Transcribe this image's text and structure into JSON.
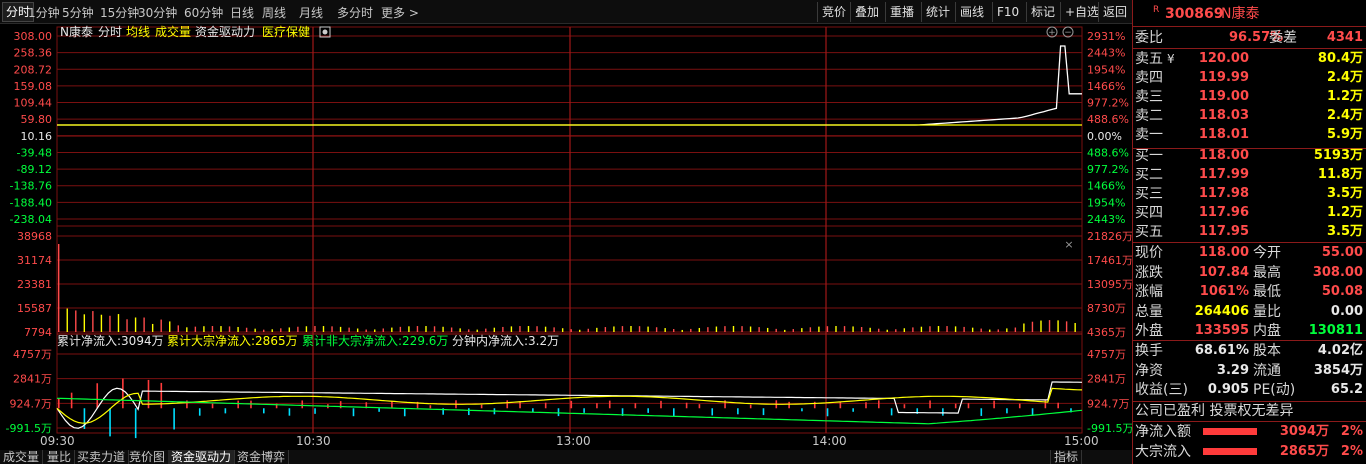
{
  "toolbar": {
    "periods": [
      "分时",
      "1分钟",
      "5分钟",
      "15分钟",
      "30分钟",
      "60分钟",
      "日线",
      "周线",
      "月线",
      "多分时",
      "更多 >"
    ],
    "active_index": 0,
    "right_buttons": [
      "竞价",
      "叠加",
      "重播",
      "统计",
      "画线",
      "F10",
      "标记",
      "+自选",
      "返回"
    ]
  },
  "chart_header": {
    "name": "N康泰",
    "mode": "分时",
    "avg": "均线",
    "volume": "成交量",
    "fund": "资金驱动力",
    "sector": "医疗保健"
  },
  "price_panel": {
    "left_ticks": [
      "308.00",
      "258.36",
      "208.72",
      "159.08",
      "109.44",
      "59.80",
      "10.16",
      "-39.48",
      "-89.12",
      "-138.76",
      "-188.40",
      "-238.04"
    ],
    "right_ticks": [
      "2931%",
      "2443%",
      "1954%",
      "1466%",
      "977.2%",
      "488.6%",
      "0.00%",
      "488.6%",
      "977.2%",
      "1466%",
      "1954%",
      "2443%"
    ]
  },
  "volume_panel": {
    "left_ticks": [
      "38968",
      "31174",
      "23381",
      "15587",
      "7794"
    ],
    "right_ticks": [
      "21826万",
      "17461万",
      "13095万",
      "8730万",
      "4365万"
    ]
  },
  "flow_panel": {
    "legend": [
      {
        "text": "累计净流入:3094万",
        "color": "#e8e8e8"
      },
      {
        "text": "累计大宗净流入:2865万",
        "color": "#ffff00"
      },
      {
        "text": "累计非大宗净流入:229.6万",
        "color": "#00ff3c"
      },
      {
        "text": "分钟内净流入:3.2万",
        "color": "#e8e8e8"
      }
    ],
    "left_ticks": [
      "4757万",
      "2841万",
      "924.7万",
      "-991.5万"
    ],
    "right_ticks": [
      "4757万",
      "2841万",
      "924.7万",
      "-991.5万"
    ]
  },
  "time_axis": [
    "09:30",
    "10:30",
    "13:00",
    "14:00",
    "15:00"
  ],
  "bottom_tabs": [
    "成交量",
    "量比",
    "买卖力道",
    "竞价图",
    "资金驱动力",
    "资金博弈"
  ],
  "bottom_active": 4,
  "bottom_right": "指标",
  "quote": {
    "code": "300869",
    "name": "N康泰",
    "weibi_label": "委比",
    "weibi": "96.57%",
    "weicha_label": "委差",
    "weicha": "4341",
    "asks": [
      {
        "label": "卖五",
        "price": "120.00",
        "vol": "80.4万"
      },
      {
        "label": "卖四",
        "price": "119.99",
        "vol": "2.4万"
      },
      {
        "label": "卖三",
        "price": "119.00",
        "vol": "1.2万"
      },
      {
        "label": "卖二",
        "price": "118.03",
        "vol": "2.4万"
      },
      {
        "label": "卖一",
        "price": "118.01",
        "vol": "5.9万"
      }
    ],
    "ask_symbol": "¥",
    "bids": [
      {
        "label": "买一",
        "price": "118.00",
        "vol": "5193万"
      },
      {
        "label": "买二",
        "price": "117.99",
        "vol": "11.8万"
      },
      {
        "label": "买三",
        "price": "117.98",
        "vol": "3.5万"
      },
      {
        "label": "买四",
        "price": "117.96",
        "vol": "1.2万"
      },
      {
        "label": "买五",
        "price": "117.95",
        "vol": "3.5万"
      }
    ],
    "stats": [
      {
        "l1": "现价",
        "v1": "118.00",
        "c1": "red",
        "l2": "今开",
        "v2": "55.00",
        "c2": "red"
      },
      {
        "l1": "涨跌",
        "v1": "107.84",
        "c1": "red",
        "l2": "最高",
        "v2": "308.00",
        "c2": "red"
      },
      {
        "l1": "涨幅",
        "v1": "1061%",
        "c1": "red",
        "l2": "最低",
        "v2": "50.08",
        "c2": "red"
      },
      {
        "l1": "总量",
        "v1": "264406",
        "c1": "yellow",
        "l2": "量比",
        "v2": "0.00",
        "c2": "white"
      },
      {
        "l1": "外盘",
        "v1": "133595",
        "c1": "red",
        "l2": "内盘",
        "v2": "130811",
        "c2": "green"
      }
    ],
    "fund": [
      {
        "l1": "换手",
        "v1": "68.61%",
        "l2": "股本",
        "v2": "4.02亿"
      },
      {
        "l1": "净资",
        "v1": "3.29",
        "l2": "流通",
        "v2": "3854万"
      },
      {
        "l1": "收益(三)",
        "v1": "0.905",
        "l2": "PE(动)",
        "v2": "65.2"
      }
    ],
    "notice": "公司已盈利 投票权无差异",
    "flows": [
      {
        "label": "净流入额",
        "value": "3094万",
        "pct": "2%"
      },
      {
        "label": "大宗流入",
        "value": "2865万",
        "pct": "2%"
      }
    ]
  },
  "colors": {
    "up": "#ff4b4b",
    "down": "#00ff3c",
    "grid": "#7a1010",
    "avg": "#ffff00",
    "price": "#ffffff"
  }
}
